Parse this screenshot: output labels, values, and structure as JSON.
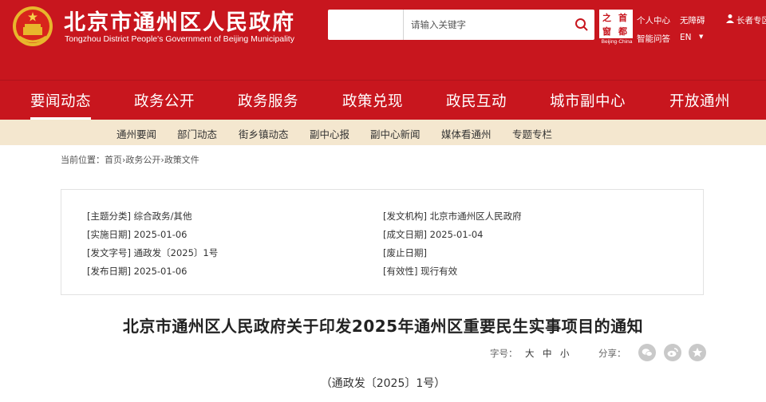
{
  "header": {
    "title": "北京市通州区人民政府",
    "subtitle": "Tongzhou District People's Government of Beijing Municipality",
    "search": {
      "placeholder": "请输入关键字"
    },
    "capital_logo": {
      "chars": [
        "之",
        "首",
        "窗",
        "都"
      ],
      "caption": "Beijing·China"
    },
    "links": {
      "personal_center": "个人中心",
      "accessibility": "无障碍",
      "smart_qa": "智能问答",
      "language": "EN",
      "elderly": "长者专区"
    }
  },
  "main_nav": [
    "要闻动态",
    "政务公开",
    "政务服务",
    "政策兑现",
    "政民互动",
    "城市副中心",
    "开放通州"
  ],
  "sub_nav": [
    "通州要闻",
    "部门动态",
    "街乡镇动态",
    "副中心报",
    "副中心新闻",
    "媒体看通州",
    "专题专栏"
  ],
  "breadcrumb": {
    "prefix": "当前位置：",
    "items": [
      "首页",
      "政务公开",
      "政策文件"
    ],
    "separator": "›"
  },
  "info": {
    "topic": {
      "label": "[主题分类]",
      "value": "综合政务/其他"
    },
    "issuer": {
      "label": "[发文机构]",
      "value": "北京市通州区人民政府"
    },
    "effective_date": {
      "label": "[实施日期]",
      "value": "2025-01-06"
    },
    "written_date": {
      "label": "[成文日期]",
      "value": "2025-01-04"
    },
    "doc_no": {
      "label": "[发文字号]",
      "value": "通政发〔2025〕1号"
    },
    "abolish_date": {
      "label": "[废止日期]",
      "value": ""
    },
    "publish_date": {
      "label": "[发布日期]",
      "value": "2025-01-06"
    },
    "validity": {
      "label": "[有效性]",
      "value": "现行有效"
    }
  },
  "article": {
    "title": "北京市通州区人民政府关于印发2025年通州区重要民生实事项目的通知",
    "font_label": "字号：",
    "font_sizes": [
      "大",
      "中",
      "小"
    ],
    "share_label": "分享：",
    "doc_number": "（通政发〔2025〕1号）"
  },
  "colors": {
    "brand_red": "#c8161e",
    "subnav_bg": "#f4e7cf",
    "share_grey": "#c9c9c9"
  },
  "icons": {
    "emblem": "national-emblem-icon",
    "search": "search-icon",
    "person": "person-icon",
    "share": [
      "wechat-icon",
      "weibo-icon",
      "star-icon"
    ]
  }
}
